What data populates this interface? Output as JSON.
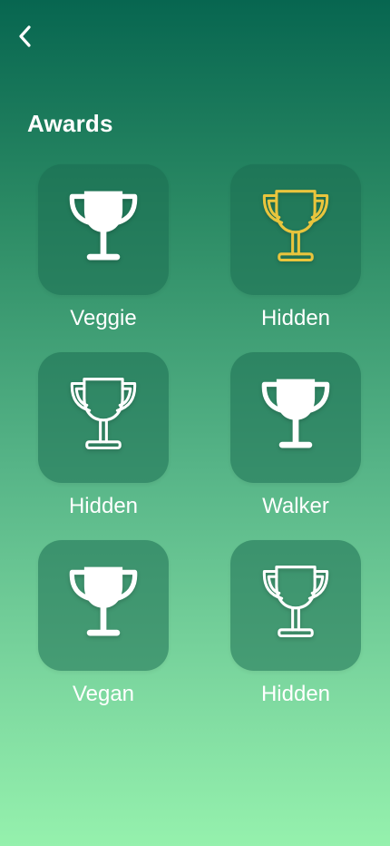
{
  "header": {
    "back_icon": "chevron-left-icon",
    "title": "Awards"
  },
  "awards": [
    {
      "label": "Veggie",
      "icon": "trophy-filled-icon",
      "color": "#ffffff"
    },
    {
      "label": "Hidden",
      "icon": "trophy-outline-icon",
      "color": "#e9c53d"
    },
    {
      "label": "Hidden",
      "icon": "trophy-outline-icon",
      "color": "#ffffff"
    },
    {
      "label": "Walker",
      "icon": "trophy-filled-icon",
      "color": "#ffffff"
    },
    {
      "label": "Vegan",
      "icon": "trophy-filled-icon",
      "color": "#ffffff"
    },
    {
      "label": "Hidden",
      "icon": "trophy-outline-icon",
      "color": "#ffffff"
    }
  ]
}
